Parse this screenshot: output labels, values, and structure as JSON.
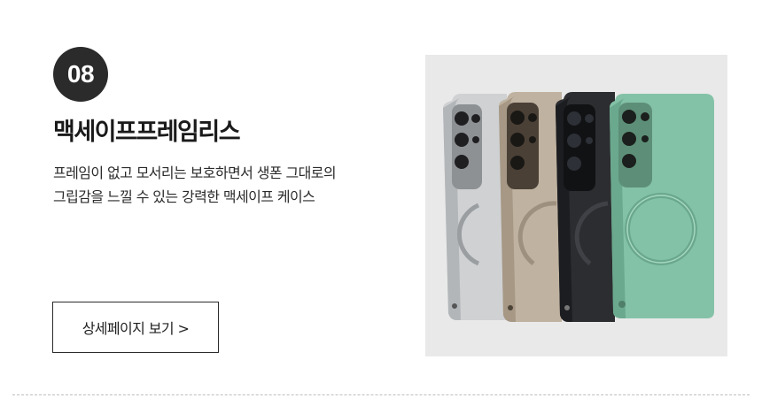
{
  "item": {
    "number": "08",
    "title": "맥세이프프레임리스",
    "description": [
      "프레임이 없고 모서리는 보호하면서 생폰 그대로의",
      "그립감을 느낄 수 있는 강력한 맥세이프 케이스"
    ],
    "cta_label": "상세페이지 보기 >"
  },
  "product_image": {
    "cases": [
      {
        "color_name": "silver",
        "body": "#cfd1d3",
        "edge": "#b3b6b9"
      },
      {
        "color_name": "titanium",
        "body": "#bfb2a0",
        "edge": "#a69885"
      },
      {
        "color_name": "black",
        "body": "#2c2d30",
        "edge": "#1c1d20"
      },
      {
        "color_name": "mint",
        "body": "#84c2a7",
        "edge": "#6ba98e"
      }
    ],
    "background": "#e9e9e9"
  }
}
